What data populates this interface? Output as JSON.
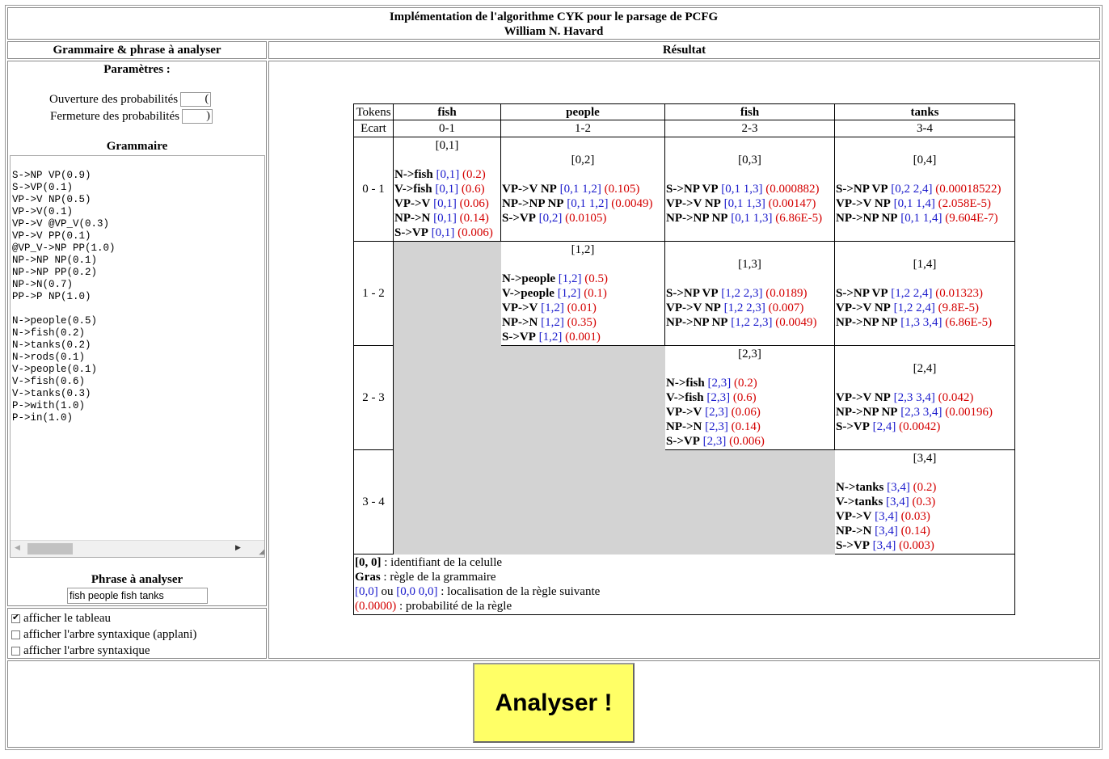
{
  "header": {
    "title": "Implémentation de l'algorithme CYK pour le parsage de PCFG",
    "author": "William N. Havard"
  },
  "left": {
    "title": "Grammaire & phrase à analyser",
    "params_title": "Paramètres :",
    "open_label": "Ouverture des probabilités",
    "open_value": "(",
    "close_label": "Fermeture des probabilités",
    "close_value": ")",
    "grammar_title": "Grammaire",
    "grammar_text": "S->NP VP(0.9)\nS->VP(0.1)\nVP->V NP(0.5)\nVP->V(0.1)\nVP->V @VP_V(0.3)\nVP->V PP(0.1)\n@VP_V->NP PP(1.0)\nNP->NP NP(0.1)\nNP->NP PP(0.2)\nNP->N(0.7)\nPP->P NP(1.0)\n\nN->people(0.5)\nN->fish(0.2)\nN->tanks(0.2)\nN->rods(0.1)\nV->people(0.1)\nV->fish(0.6)\nV->tanks(0.3)\nP->with(1.0)\nP->in(1.0)",
    "sentence_title": "Phrase à analyser",
    "sentence_value": "fish people fish tanks",
    "options": [
      {
        "label": "afficher le tableau",
        "checked": true
      },
      {
        "label": "afficher l'arbre syntaxique (applani)",
        "checked": false
      },
      {
        "label": "afficher l'arbre syntaxique",
        "checked": false
      }
    ]
  },
  "result": {
    "title": "Résultat",
    "tokens_label": "Tokens",
    "ecart_label": "Ecart",
    "tokens": [
      "fish",
      "people",
      "fish",
      "tanks"
    ],
    "spans": [
      "0-1",
      "1-2",
      "2-3",
      "3-4"
    ],
    "row_labels": [
      "0 - 1",
      "1 - 2",
      "2 - 3",
      "3 - 4"
    ],
    "cells": {
      "c01": {
        "id": "[0,1]",
        "rules": [
          {
            "rule": "N->fish",
            "loc": "[0,1]",
            "prob": "(0.2)"
          },
          {
            "rule": "V->fish",
            "loc": "[0,1]",
            "prob": "(0.6)"
          },
          {
            "rule": "VP->V",
            "loc": "[0,1]",
            "prob": "(0.06)"
          },
          {
            "rule": "NP->N",
            "loc": "[0,1]",
            "prob": "(0.14)"
          },
          {
            "rule": "S->VP",
            "loc": "[0,1]",
            "prob": "(0.006)"
          }
        ]
      },
      "c02": {
        "id": "[0,2]",
        "rules": [
          {
            "rule": "VP->V NP",
            "loc": "[0,1 1,2]",
            "prob": "(0.105)"
          },
          {
            "rule": "NP->NP NP",
            "loc": "[0,1 1,2]",
            "prob": "(0.0049)"
          },
          {
            "rule": "S->VP",
            "loc": "[0,2]",
            "prob": "(0.0105)"
          }
        ]
      },
      "c03": {
        "id": "[0,3]",
        "rules": [
          {
            "rule": "S->NP VP",
            "loc": "[0,1 1,3]",
            "prob": "(0.000882)"
          },
          {
            "rule": "VP->V NP",
            "loc": "[0,1 1,3]",
            "prob": "(0.00147)"
          },
          {
            "rule": "NP->NP NP",
            "loc": "[0,1 1,3]",
            "prob": "(6.86E-5)"
          }
        ]
      },
      "c04": {
        "id": "[0,4]",
        "rules": [
          {
            "rule": "S->NP VP",
            "loc": "[0,2 2,4]",
            "prob": "(0.00018522)"
          },
          {
            "rule": "VP->V NP",
            "loc": "[0,1 1,4]",
            "prob": "(2.058E-5)"
          },
          {
            "rule": "NP->NP NP",
            "loc": "[0,1 1,4]",
            "prob": "(9.604E-7)"
          }
        ]
      },
      "c12": {
        "id": "[1,2]",
        "rules": [
          {
            "rule": "N->people",
            "loc": "[1,2]",
            "prob": "(0.5)"
          },
          {
            "rule": "V->people",
            "loc": "[1,2]",
            "prob": "(0.1)"
          },
          {
            "rule": "VP->V",
            "loc": "[1,2]",
            "prob": "(0.01)"
          },
          {
            "rule": "NP->N",
            "loc": "[1,2]",
            "prob": "(0.35)"
          },
          {
            "rule": "S->VP",
            "loc": "[1,2]",
            "prob": "(0.001)"
          }
        ]
      },
      "c13": {
        "id": "[1,3]",
        "rules": [
          {
            "rule": "S->NP VP",
            "loc": "[1,2 2,3]",
            "prob": "(0.0189)"
          },
          {
            "rule": "VP->V NP",
            "loc": "[1,2 2,3]",
            "prob": "(0.007)"
          },
          {
            "rule": "NP->NP NP",
            "loc": "[1,2 2,3]",
            "prob": "(0.0049)"
          }
        ]
      },
      "c14": {
        "id": "[1,4]",
        "rules": [
          {
            "rule": "S->NP VP",
            "loc": "[1,2 2,4]",
            "prob": "(0.01323)"
          },
          {
            "rule": "VP->V NP",
            "loc": "[1,2 2,4]",
            "prob": "(9.8E-5)"
          },
          {
            "rule": "NP->NP NP",
            "loc": "[1,3 3,4]",
            "prob": "(6.86E-5)"
          }
        ]
      },
      "c23": {
        "id": "[2,3]",
        "rules": [
          {
            "rule": "N->fish",
            "loc": "[2,3]",
            "prob": "(0.2)"
          },
          {
            "rule": "V->fish",
            "loc": "[2,3]",
            "prob": "(0.6)"
          },
          {
            "rule": "VP->V",
            "loc": "[2,3]",
            "prob": "(0.06)"
          },
          {
            "rule": "NP->N",
            "loc": "[2,3]",
            "prob": "(0.14)"
          },
          {
            "rule": "S->VP",
            "loc": "[2,3]",
            "prob": "(0.006)"
          }
        ]
      },
      "c24": {
        "id": "[2,4]",
        "rules": [
          {
            "rule": "VP->V NP",
            "loc": "[2,3 3,4]",
            "prob": "(0.042)"
          },
          {
            "rule": "NP->NP NP",
            "loc": "[2,3 3,4]",
            "prob": "(0.00196)"
          },
          {
            "rule": "S->VP",
            "loc": "[2,4]",
            "prob": "(0.0042)"
          }
        ]
      },
      "c34": {
        "id": "[3,4]",
        "rules": [
          {
            "rule": "N->tanks",
            "loc": "[3,4]",
            "prob": "(0.2)"
          },
          {
            "rule": "V->tanks",
            "loc": "[3,4]",
            "prob": "(0.3)"
          },
          {
            "rule": "VP->V",
            "loc": "[3,4]",
            "prob": "(0.03)"
          },
          {
            "rule": "NP->N",
            "loc": "[3,4]",
            "prob": "(0.14)"
          },
          {
            "rule": "S->VP",
            "loc": "[3,4]",
            "prob": "(0.003)"
          }
        ]
      }
    },
    "legend": {
      "l1_bold": "[0, 0]",
      "l1_text": " : identifiant de la celulle",
      "l2_bold": "Gras",
      "l2_text": " : règle de la grammaire",
      "l3_blue1": "[0,0]",
      "l3_mid": " ou ",
      "l3_blue2": "[0,0 0,0]",
      "l3_text": " : localisation de la règle suivante",
      "l4_red": "(0.0000)",
      "l4_text": " : probabilité de la règle"
    }
  },
  "footer": {
    "button_label": "Analyser !",
    "button_color": "#ffff66"
  }
}
